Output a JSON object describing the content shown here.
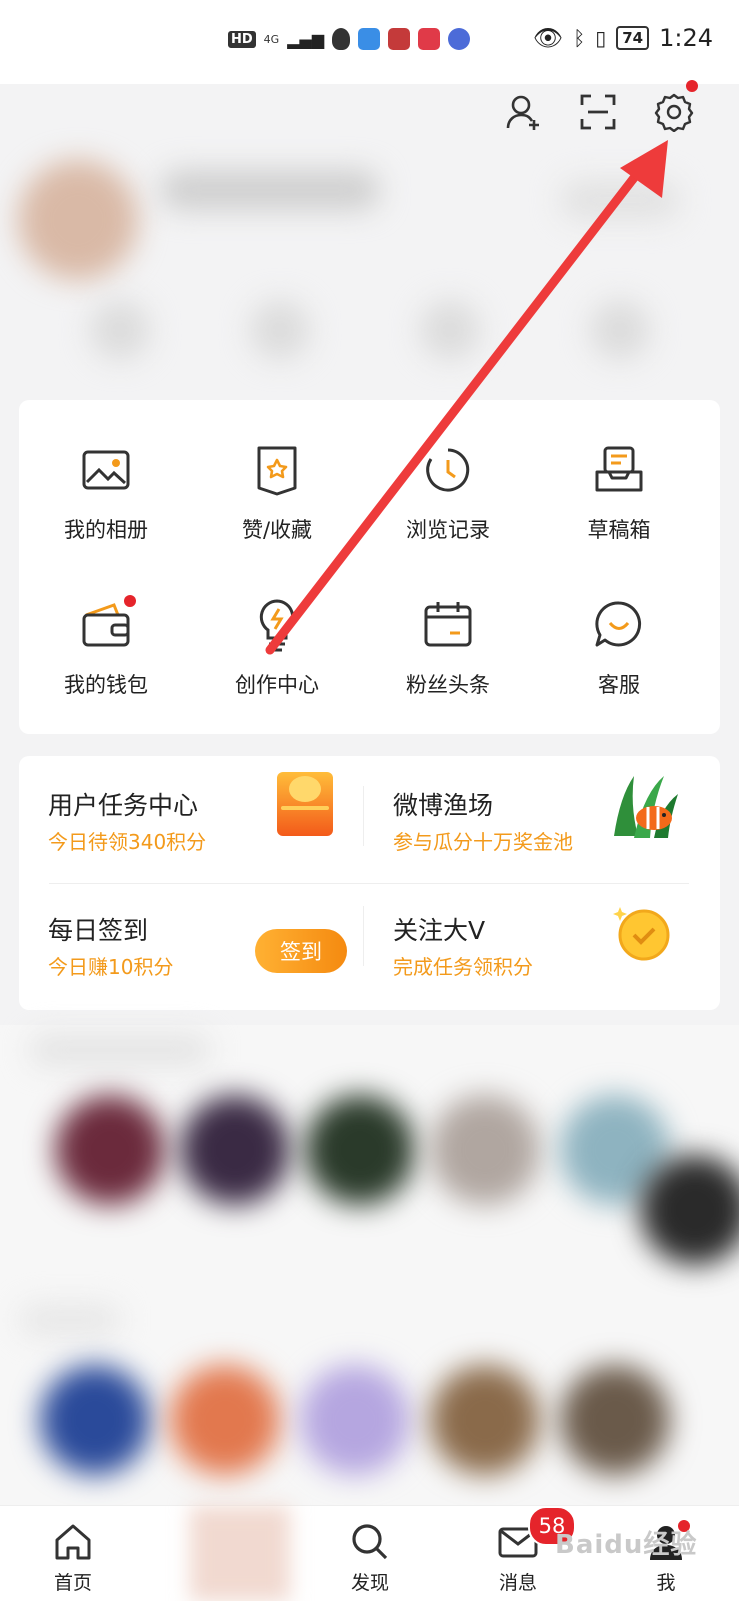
{
  "status_bar": {
    "left_badges": [
      "HD",
      "4G"
    ],
    "time": "1:24",
    "battery": "74"
  },
  "top_bar": {
    "icons": [
      "add-friend-icon",
      "scan-icon",
      "settings-icon"
    ]
  },
  "quick_grid": [
    {
      "label": "我的相册",
      "icon": "photo-album-icon"
    },
    {
      "label": "赞/收藏",
      "icon": "likes-favorites-icon"
    },
    {
      "label": "浏览记录",
      "icon": "history-icon"
    },
    {
      "label": "草稿箱",
      "icon": "drafts-icon"
    },
    {
      "label": "我的钱包",
      "icon": "wallet-icon"
    },
    {
      "label": "创作中心",
      "icon": "creator-center-icon"
    },
    {
      "label": "粉丝头条",
      "icon": "fan-headlines-icon"
    },
    {
      "label": "客服",
      "icon": "customer-service-icon"
    }
  ],
  "tasks": {
    "task_center": {
      "title": "用户任务中心",
      "subtitle": "今日待领340积分"
    },
    "fishery": {
      "title": "微博渔场",
      "subtitle": "参与瓜分十万奖金池"
    },
    "daily_checkin": {
      "title": "每日签到",
      "subtitle": "今日赚10积分",
      "button": "签到"
    },
    "follow_v": {
      "title": "关注大V",
      "subtitle": "完成任务领积分"
    }
  },
  "tab_bar": [
    {
      "label": "首页",
      "icon": "home-icon"
    },
    {
      "label": "发现",
      "icon": "search-icon"
    },
    {
      "label": "消息",
      "icon": "message-icon",
      "badge": "58"
    },
    {
      "label": "我",
      "icon": "profile-icon"
    }
  ],
  "watermark": "Baidu经验",
  "colors": {
    "accent": "#f58a10",
    "badge_red": "#e5242b",
    "arrow_red": "#ee3b3b"
  }
}
